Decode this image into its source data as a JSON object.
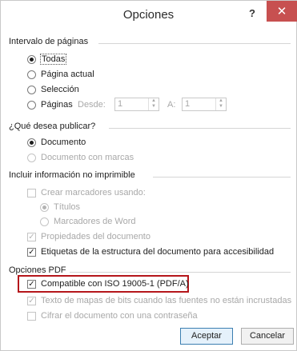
{
  "window": {
    "title": "Opciones",
    "help_glyph": "?",
    "close_glyph": "✕"
  },
  "page_range": {
    "title": "Intervalo de páginas",
    "options": [
      {
        "label": "Todas",
        "selected": true
      },
      {
        "label": "Página actual",
        "selected": false
      },
      {
        "label": "Selección",
        "selected": false
      },
      {
        "label": "Páginas",
        "selected": false
      }
    ],
    "from_label": "Desde:",
    "from_value": "1",
    "to_label": "A:",
    "to_value": "1"
  },
  "publish": {
    "title": "¿Qué desea publicar?",
    "options": [
      {
        "label": "Documento",
        "selected": true,
        "enabled": true
      },
      {
        "label": "Documento con marcas",
        "selected": false,
        "enabled": false
      }
    ]
  },
  "nonprint": {
    "title": "Incluir información no imprimible",
    "create_bookmarks": {
      "label": "Crear marcadores usando:",
      "checked": false,
      "enabled": false
    },
    "bookmark_options": [
      {
        "label": "Títulos",
        "selected": true
      },
      {
        "label": "Marcadores de Word",
        "selected": false
      }
    ],
    "doc_properties": {
      "label": "Propiedades del documento",
      "checked": true,
      "enabled": false
    },
    "structure_tags": {
      "label": "Etiquetas de la estructura del documento para accesibilidad",
      "checked": true,
      "enabled": true
    }
  },
  "pdf": {
    "title": "Opciones PDF",
    "iso": {
      "label": "Compatible con ISO 19005-1 (PDF/A)",
      "checked": true,
      "enabled": true
    },
    "bitmap_text": {
      "label": "Texto de mapas de bits cuando las fuentes no están incrustadas",
      "checked": true,
      "enabled": false
    },
    "encrypt": {
      "label": "Cifrar el documento con una contraseña",
      "checked": false,
      "enabled": false
    }
  },
  "buttons": {
    "accept": "Aceptar",
    "cancel": "Cancelar"
  },
  "colors": {
    "close_bg": "#c75050",
    "highlight": "#b5161b",
    "default_button_border": "#3c7fb1"
  }
}
